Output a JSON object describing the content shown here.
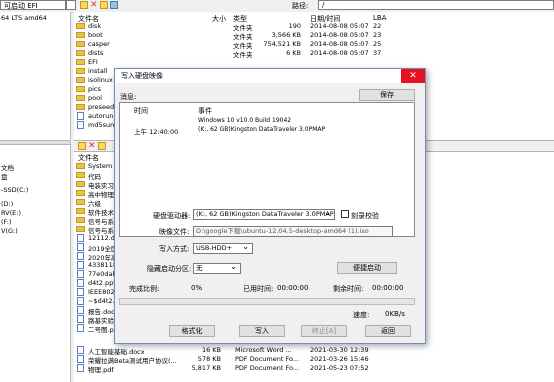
{
  "toolbar": {
    "volume_label": "可启动 EFI",
    "path_label": "路径:",
    "path_value": "/"
  },
  "left_pane": {
    "top_items": [
      "64 LTS amd64"
    ],
    "bottom_items": [
      "文档",
      "盘",
      "-SSD(C:)",
      "(D:)",
      "RV(E:)",
      "(F:)",
      "V(G:)"
    ]
  },
  "file_list": {
    "columns": {
      "name": "文件名",
      "size": "大小",
      "type": "类型",
      "date": "日期/时间",
      "lba": "LBA"
    },
    "rows": [
      {
        "name": "disk",
        "size": "190",
        "type": "文件夹",
        "date": "2014-08-08 05:07",
        "lba": "22",
        "icon": "folder"
      },
      {
        "name": "boot",
        "size": "3,566 KB",
        "type": "文件夹",
        "date": "2014-08-08 05:07",
        "lba": "23",
        "icon": "folder"
      },
      {
        "name": "casper",
        "size": "754,521 KB",
        "type": "文件夹",
        "date": "2014-08-08 05:07",
        "lba": "25",
        "icon": "folder"
      },
      {
        "name": "dists",
        "size": "6 KB",
        "type": "文件夹",
        "date": "2014-08-08 05:07",
        "lba": "37",
        "icon": "folder"
      },
      {
        "name": "EFI",
        "size": "",
        "type": "",
        "date": "",
        "lba": "",
        "icon": "folder"
      },
      {
        "name": "install",
        "size": "",
        "type": "",
        "date": "",
        "lba": "",
        "icon": "folder"
      },
      {
        "name": "isolinux",
        "size": "",
        "type": "",
        "date": "",
        "lba": "",
        "icon": "folder"
      },
      {
        "name": "pics",
        "size": "",
        "type": "",
        "date": "",
        "lba": "",
        "icon": "folder"
      },
      {
        "name": "pool",
        "size": "",
        "type": "",
        "date": "",
        "lba": "",
        "icon": "folder"
      },
      {
        "name": "preseed",
        "size": "",
        "type": "",
        "date": "",
        "lba": "",
        "icon": "folder"
      },
      {
        "name": "autorun.in",
        "size": "",
        "type": "",
        "date": "",
        "lba": "",
        "icon": "doc"
      },
      {
        "name": "md5sum.txt",
        "size": "",
        "type": "",
        "date": "",
        "lba": "",
        "icon": "doc"
      }
    ]
  },
  "lower_list": {
    "column_name": "文件名",
    "rows": [
      {
        "name": "System Volu",
        "icon": "folder"
      },
      {
        "name": "代码",
        "icon": "folder"
      },
      {
        "name": "电装实习",
        "icon": "folder"
      },
      {
        "name": "高中物理",
        "icon": "folder"
      },
      {
        "name": "六级",
        "icon": "folder"
      },
      {
        "name": "软件技术基",
        "icon": "folder"
      },
      {
        "name": "信号与系统",
        "icon": "folder"
      },
      {
        "name": "信号与系统",
        "icon": "folder"
      },
      {
        "name": "12112.doc",
        "icon": "doc"
      },
      {
        "name": "2019全国三",
        "icon": "doc"
      },
      {
        "name": "2020年高考",
        "icon": "doc"
      },
      {
        "name": "4338118_@",
        "icon": "doc"
      },
      {
        "name": "77e0dab3.g",
        "icon": "doc"
      },
      {
        "name": "d4t2.pptx",
        "icon": "doc"
      },
      {
        "name": "IEEE802.11",
        "icon": "doc"
      },
      {
        "name": "~$d4t2.pptx",
        "icon": "doc"
      },
      {
        "name": "报告.docx",
        "icon": "doc"
      },
      {
        "name": "路基实验报",
        "icon": "doc"
      },
      {
        "name": "二号图.pdf",
        "icon": "doc"
      }
    ],
    "visible_rows": [
      {
        "name": "人工智能基础.docx",
        "size": "16 KB",
        "type": "Microsoft Word ...",
        "date": "2021-03-30 12:39",
        "icon": "doc"
      },
      {
        "name": "荣耀拉满Beta测试用户协议(...",
        "size": "578 KB",
        "type": "PDF Document Fo...",
        "date": "2021-03-26 15:46",
        "icon": "doc"
      },
      {
        "name": "物理.pdf",
        "size": "5,817 KB",
        "type": "PDF Document Fo...",
        "date": "2021-05-23 07:52",
        "icon": "doc"
      }
    ]
  },
  "dialog": {
    "title": "写入硬盘映像",
    "close": "✕",
    "message_label": "消息:",
    "save_button": "保存",
    "log_header": {
      "time": "时间",
      "event": "事件"
    },
    "log_rows": [
      {
        "time": "",
        "event": "Windows 10 v10.0 Build 19042"
      },
      {
        "time": "上午 12:40:00",
        "event": "(K:, 62 GB)Kingston DataTraveler 3.0PMAP"
      }
    ],
    "drive_label": "硬盘驱动器:",
    "drive_value": "(K:, 62 GB)Kingston DataTraveler 3.0PMAP",
    "verify_label": "刻录校验",
    "image_label": "映像文件:",
    "image_value": "D:\\google下载\\ubuntu-12.04.5-desktop-amd64 (1).iso",
    "write_mode_label": "写入方式:",
    "write_mode_value": "USB-HDD+",
    "hidden_label": "隐藏启动分区:",
    "hidden_value": "无",
    "boot_button": "便捷启动",
    "complete_label": "完成比例:",
    "complete_value": "0%",
    "elapsed_label": "已用时间:",
    "elapsed_value": "00:00:00",
    "remaining_label": "剩余时间:",
    "remaining_value": "00:00:00",
    "progress": 0,
    "speed_label": "速度:",
    "speed_value": "0KB/s",
    "format_button": "格式化",
    "write_button": "写入",
    "stop_button": "终止[A]",
    "back_button": "返回"
  }
}
